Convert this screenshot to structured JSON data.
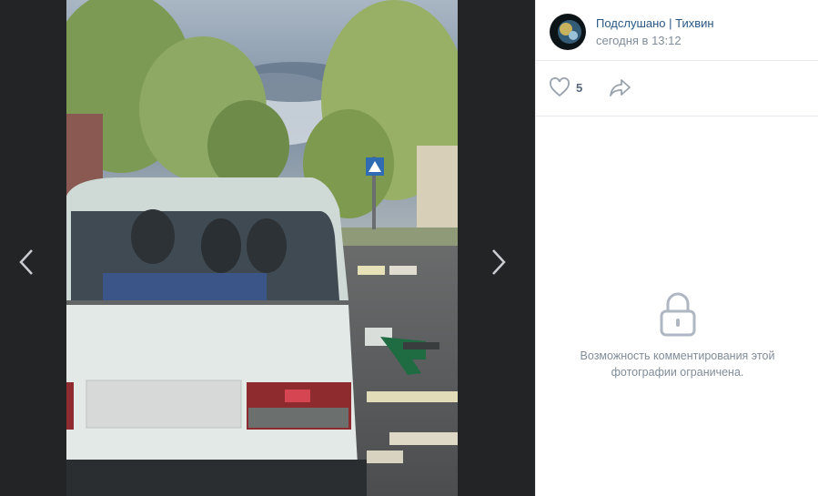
{
  "post": {
    "author": "Подслушано | Тихвин",
    "date": "сегодня в 13:12",
    "likes": "5"
  },
  "comments": {
    "closed_text": "Возможность комментирования этой фотографии ограничена."
  },
  "icons": {
    "prev": "chevron-left-icon",
    "next": "chevron-right-icon",
    "like": "heart-icon",
    "share": "share-arrow-icon",
    "lock": "lock-icon"
  },
  "colors": {
    "link": "#2a5885",
    "secondary": "#818c99",
    "viewer_bg": "#222426"
  }
}
